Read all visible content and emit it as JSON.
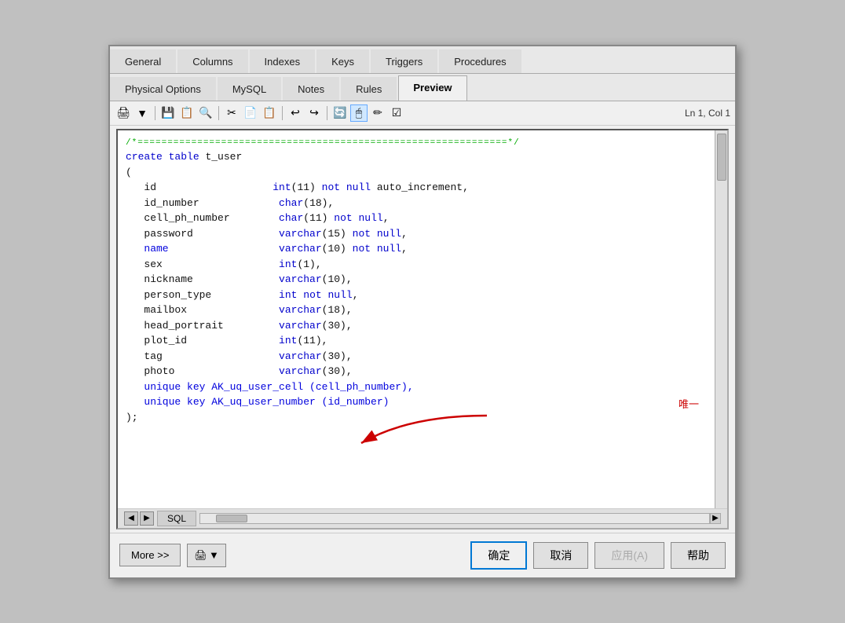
{
  "tabs_row1": [
    {
      "label": "General",
      "active": false
    },
    {
      "label": "Columns",
      "active": false
    },
    {
      "label": "Indexes",
      "active": false
    },
    {
      "label": "Keys",
      "active": false
    },
    {
      "label": "Triggers",
      "active": false
    },
    {
      "label": "Procedures",
      "active": false
    }
  ],
  "tabs_row2": [
    {
      "label": "Physical Options",
      "active": false
    },
    {
      "label": "MySQL",
      "active": false
    },
    {
      "label": "Notes",
      "active": false
    },
    {
      "label": "Rules",
      "active": false
    },
    {
      "label": "Preview",
      "active": true
    }
  ],
  "toolbar": {
    "status": "Ln 1, Col 1"
  },
  "code": {
    "green_line": "/*==============================================================*/",
    "lines": [
      {
        "text": "create table t_user",
        "type": "keyword_mixed"
      },
      {
        "text": "(",
        "type": "black"
      },
      {
        "text": "   id                   int(11) not null auto_increment,",
        "type": "mixed"
      },
      {
        "text": "   id_number             char(18),",
        "type": "mixed"
      },
      {
        "text": "   cell_ph_number        char(11) not null,",
        "type": "mixed"
      },
      {
        "text": "   password              varchar(15) not null,",
        "type": "mixed"
      },
      {
        "text": "   name                  varchar(10) not null,",
        "type": "blue_field"
      },
      {
        "text": "   sex                   int(1),",
        "type": "mixed"
      },
      {
        "text": "   nickname              varchar(10),",
        "type": "mixed"
      },
      {
        "text": "   person_type           int not null,",
        "type": "mixed"
      },
      {
        "text": "   mailbox               varchar(18),",
        "type": "mixed"
      },
      {
        "text": "   head_portrait         varchar(30),",
        "type": "mixed"
      },
      {
        "text": "   plot_id               int(11),",
        "type": "mixed"
      },
      {
        "text": "   tag                   varchar(30),",
        "type": "mixed"
      },
      {
        "text": "   photo                 varchar(30),",
        "type": "mixed"
      },
      {
        "text": "   unique key AK_uq_user_cell (cell_ph_number),",
        "type": "unique"
      },
      {
        "text": "   unique key AK_uq_user_number (id_number)",
        "type": "unique"
      },
      {
        "text": ");",
        "type": "black"
      }
    ]
  },
  "bottom_sql_tab": "SQL",
  "buttons": {
    "more": "More >>",
    "confirm": "确定",
    "cancel": "取消",
    "apply": "应用(A)",
    "help": "帮助"
  },
  "annotation": {
    "chinese": "唯一"
  }
}
